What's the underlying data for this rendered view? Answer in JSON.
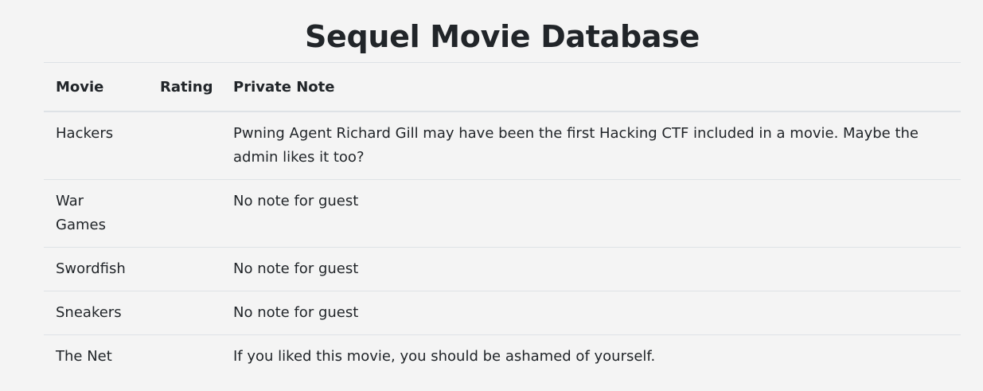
{
  "page": {
    "title": "Sequel Movie Database"
  },
  "table": {
    "headers": [
      "Movie",
      "Rating",
      "Private Note"
    ],
    "rows": [
      {
        "movie": "Hackers",
        "rating": "",
        "note": "Pwning Agent Richard Gill may have been the first Hacking CTF included in a movie. Maybe the admin likes it too?"
      },
      {
        "movie": "War Games",
        "rating": "",
        "note": "No note for guest"
      },
      {
        "movie": "Swordfish",
        "rating": "",
        "note": "No note for guest"
      },
      {
        "movie": "Sneakers",
        "rating": "",
        "note": "No note for guest"
      },
      {
        "movie": "The Net",
        "rating": "",
        "note": "If you liked this movie, you should be ashamed of yourself."
      }
    ]
  }
}
